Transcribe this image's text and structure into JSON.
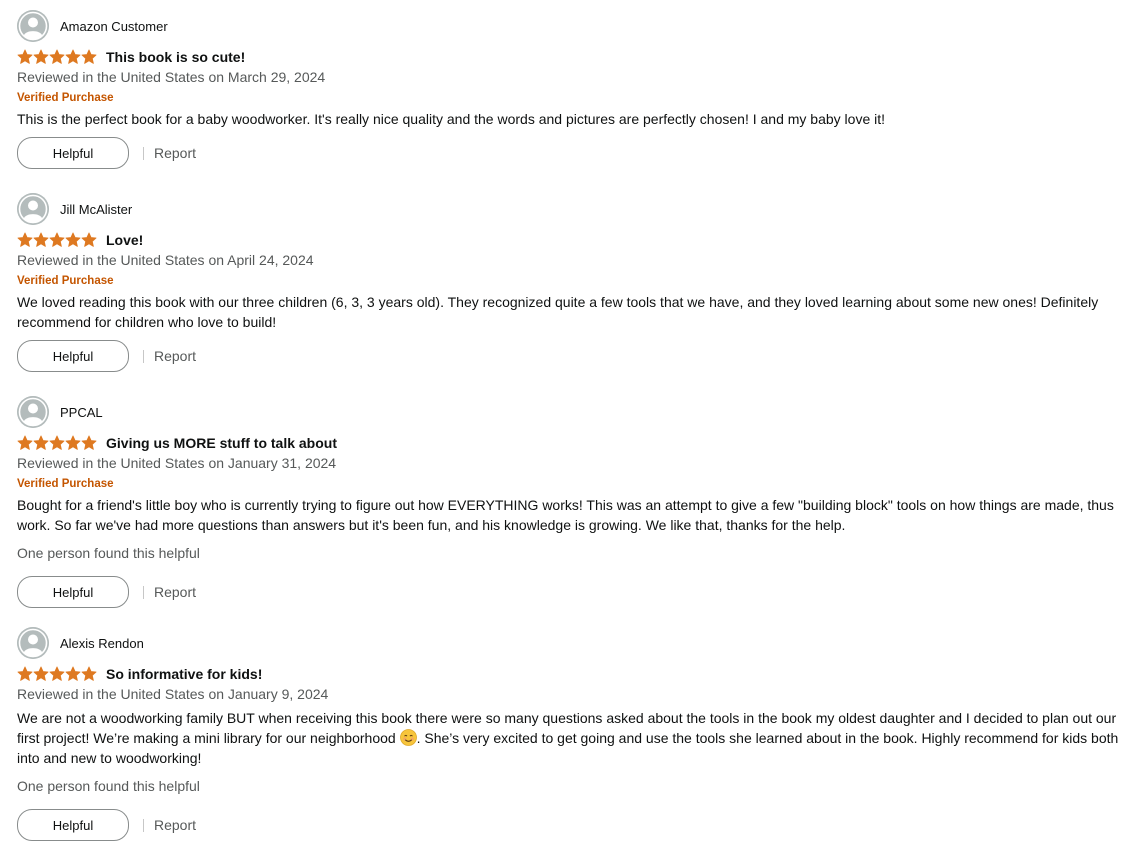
{
  "reviews": [
    {
      "reviewer": "Amazon Customer",
      "rating": 5,
      "max_rating": 5,
      "title": "This book is so cute!",
      "reviewed_line": "Reviewed in the United States on March 29, 2024",
      "badge": "Verified Purchase",
      "body": "This is the perfect book for a baby woodworker. It's really nice quality and the words and pictures are perfectly chosen! I and my baby love it!",
      "helpful_label": "Helpful",
      "report_label": "Report"
    },
    {
      "reviewer": "Jill McAlister",
      "rating": 5,
      "max_rating": 5,
      "title": "Love!",
      "reviewed_line": "Reviewed in the United States on April 24, 2024",
      "badge": "Verified Purchase",
      "body": "We loved reading this book with our three children (6, 3, 3 years old). They recognized quite a few tools that we have, and they loved learning about some new ones! Definitely recommend for children who love to build!",
      "helpful_label": "Helpful",
      "report_label": "Report"
    },
    {
      "reviewer": "PPCAL",
      "rating": 5,
      "max_rating": 5,
      "title": "Giving us MORE stuff to talk about",
      "reviewed_line": "Reviewed in the United States on January 31, 2024",
      "badge": "Verified Purchase",
      "body": "Bought for a friend's little boy who is currently trying to figure out how EVERYTHING works! This was an attempt to give a few \"building block\" tools on how things are made, thus work. So far we've had more questions than answers but it's been fun, and his knowledge is growing. We like that, thanks for the help.",
      "found_helpful": "One person found this helpful",
      "helpful_label": "Helpful",
      "report_label": "Report"
    },
    {
      "reviewer": "Alexis Rendon",
      "rating": 5,
      "max_rating": 5,
      "title": "So informative for kids!",
      "reviewed_line": "Reviewed in the United States on January 9, 2024",
      "body_before_emoji": "We are not a woodworking family BUT when receiving this book there were so many questions asked about the tools in the book my oldest daughter and I decided to plan out our first project! We’re making a mini library for our neighborhood ",
      "emoji_icon": "smiling-face-emoji",
      "body_after_emoji": ". She’s very excited to get going and use the tools she learned about in the book. Highly recommend for kids both into and new to woodworking!",
      "found_helpful": "One person found this helpful",
      "helpful_label": "Helpful",
      "report_label": "Report"
    }
  ],
  "colors": {
    "star": "#de7921",
    "verified": "#c45500",
    "meta_text": "#565959",
    "avatar_bg": "#b4bcbc"
  }
}
